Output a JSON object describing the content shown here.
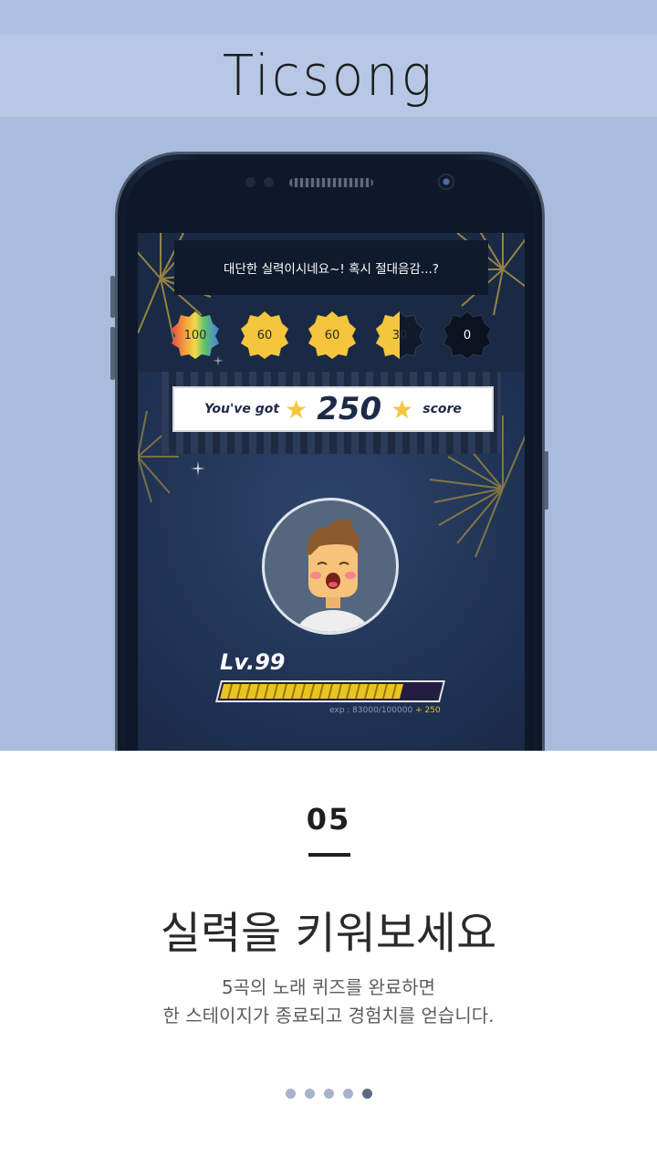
{
  "app": {
    "logo": "Ticsong"
  },
  "game": {
    "message": "대단한 실력이시네요~! 혹시 절대음감...?",
    "badges": [
      {
        "value": "100",
        "style": "rainbow"
      },
      {
        "value": "60",
        "style": "gold"
      },
      {
        "value": "60",
        "style": "gold"
      },
      {
        "value": "30",
        "style": "half"
      },
      {
        "value": "0",
        "style": "dark"
      }
    ],
    "score": {
      "prefix": "You've got",
      "value": "250",
      "suffix": "score"
    },
    "level": "Lv.99",
    "exp": {
      "text": "exp : 83000/100000",
      "bonus": "+ 250",
      "progress": 0.83
    }
  },
  "onboarding": {
    "step": "05",
    "title": "실력을 키워보세요",
    "description_line1": "5곡의 노래 퀴즈를 완료하면",
    "description_line2": "한 스테이지가 종료되고 경험치를 얻습니다.",
    "page_count": 5,
    "active_page": 5
  },
  "colors": {
    "background": "#aec0df",
    "screen": "#1f3253",
    "gold": "#f4c63d",
    "exp_bar": "#e8c41d",
    "dot_active": "#5c6a82",
    "dot_inactive": "#a7b3c8"
  }
}
